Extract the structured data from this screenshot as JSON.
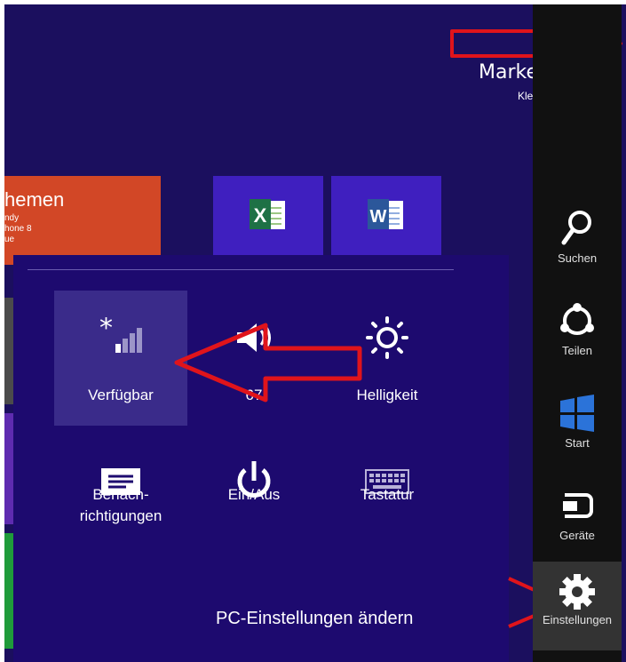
{
  "user": {
    "name": "Marke",
    "subtitle": "Kle"
  },
  "tiles": {
    "orange": {
      "title": "hemen",
      "lines": [
        "ndy",
        "hone 8",
        "ue"
      ]
    }
  },
  "quick_settings": [
    {
      "label": "Verfügbar",
      "icon": "network-signal-icon",
      "selected": true
    },
    {
      "label": "67",
      "icon": "volume-icon"
    },
    {
      "label": "Helligkeit",
      "icon": "brightness-icon"
    },
    {
      "label": "Benach-\nrichtigungen",
      "icon": "notifications-icon"
    },
    {
      "label": "Ein/Aus",
      "icon": "power-icon"
    },
    {
      "label": "Tastatur",
      "icon": "keyboard-icon"
    }
  ],
  "pc_settings_link": "PC-Einstellungen ändern",
  "charms": [
    {
      "label": "Suchen",
      "icon": "search-icon"
    },
    {
      "label": "Teilen",
      "icon": "share-icon"
    },
    {
      "label": "Start",
      "icon": "windows-logo-icon"
    },
    {
      "label": "Geräte",
      "icon": "devices-icon"
    },
    {
      "label": "Einstellungen",
      "icon": "gear-icon",
      "active": true
    }
  ],
  "colors": {
    "start_background": "#1b0f5e",
    "flyout_background": "#1d0a6f",
    "charms_background": "#111111",
    "annotation": "#e0141b"
  }
}
